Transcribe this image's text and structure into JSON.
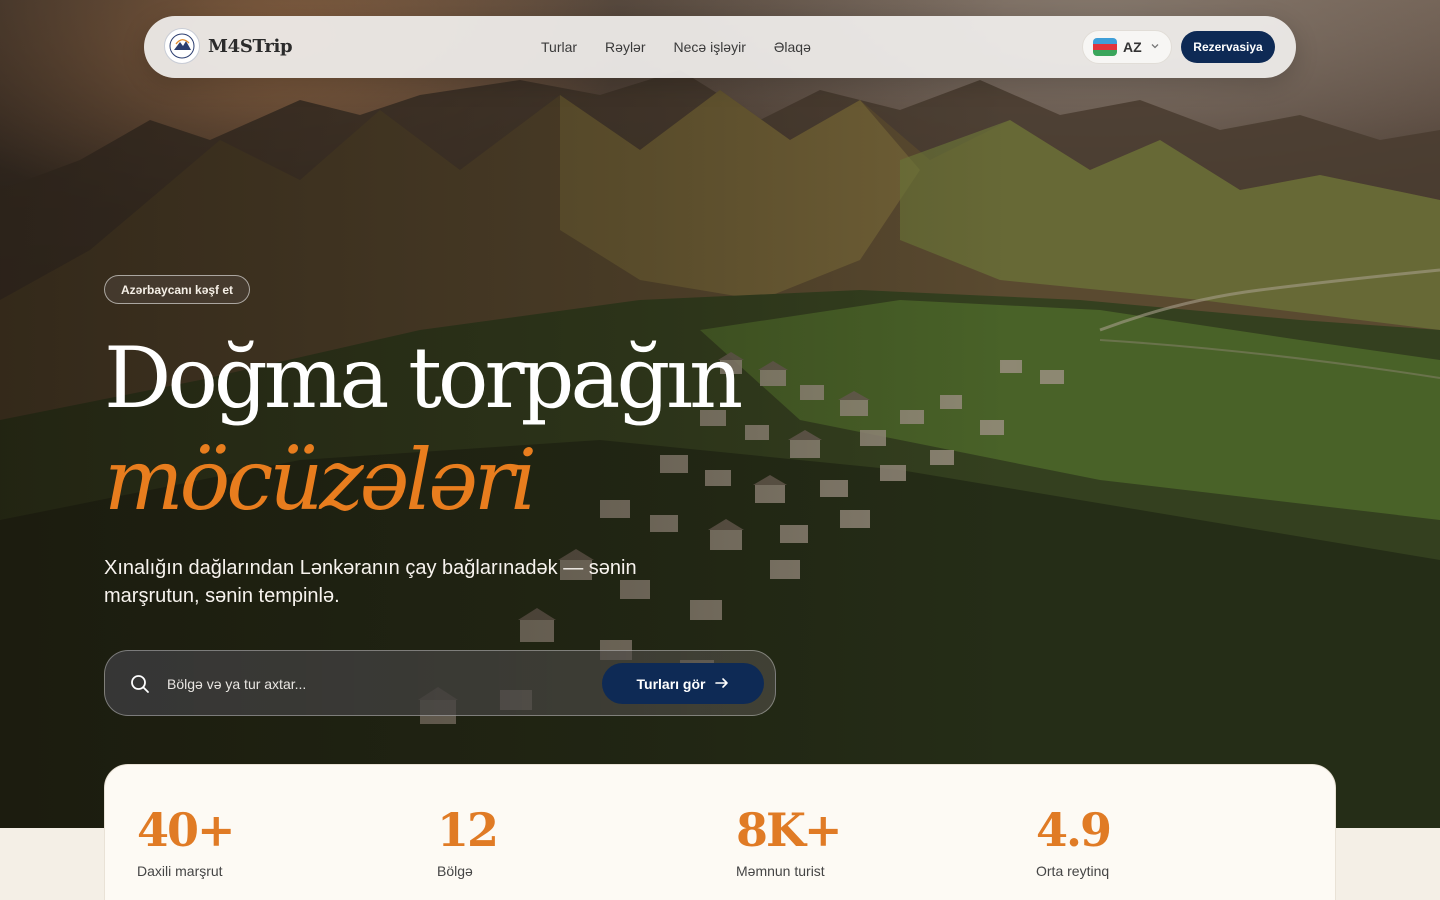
{
  "brand": {
    "name": "M4STrip"
  },
  "nav": {
    "links": [
      "Turlar",
      "Rəylər",
      "Necə işləyir",
      "Əlaqə"
    ],
    "language": "AZ",
    "book_label": "Rezervasiya"
  },
  "hero": {
    "tag": "Azərbaycanı kəşf et",
    "title_line1": "Doğma torpağın",
    "title_line2": "möcüzələri",
    "subtitle": "Xınalığın dağlarından Lənkəranın çay bağlarınadək — sənin marşrutun, sənin tempinlə."
  },
  "search": {
    "placeholder": "Bölgə və ya tur axtar...",
    "button_label": "Turları gör"
  },
  "stats": [
    {
      "value": "40+",
      "label": "Daxili marşrut"
    },
    {
      "value": "12",
      "label": "Bölgə"
    },
    {
      "value": "8K+",
      "label": "Məmnun turist"
    },
    {
      "value": "4.9",
      "label": "Orta reytinq"
    }
  ],
  "colors": {
    "accent": "#e87d1e",
    "primary": "#0e2a55"
  }
}
